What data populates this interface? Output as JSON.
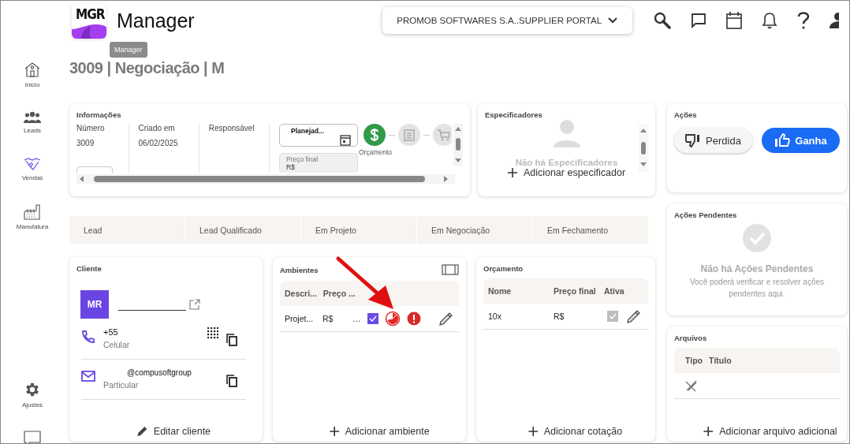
{
  "header": {
    "logo": "MGR",
    "app_name": "Manager",
    "portal": "PROMOB SOFTWARES S.A..SUPPLIER PORTAL"
  },
  "sidebar": {
    "items": [
      {
        "label": "Inicio",
        "selected": false
      },
      {
        "label": "Leads",
        "selected": false
      },
      {
        "label": "Vendas",
        "selected": true
      },
      {
        "label": "Manufatura",
        "selected": false
      }
    ],
    "bottom_items": [
      {
        "label": "Ajustes",
        "selected": false
      },
      {
        "selected": false
      }
    ]
  },
  "title": "3009 | Negociação | M",
  "tooltip": "Manager",
  "info": {
    "title": "Informações",
    "fields": [
      {
        "label": "Número",
        "value": "3009"
      },
      {
        "label": "Criado em",
        "value": "06/02/2025"
      },
      {
        "label": "Responsável"
      }
    ],
    "date_field": {
      "value": "Planejad..."
    },
    "price_field": {
      "label": "Preço final",
      "value": "R$"
    },
    "steps": [
      {
        "label": "Orçamento",
        "done": true
      },
      {
        "done": false
      },
      {
        "done": false
      }
    ]
  },
  "specifiers": {
    "title": "Especificadores",
    "empty_text": "Não há Especificadores",
    "add_label": "Adicionar especificador"
  },
  "actions": {
    "title": "Ações",
    "buttons": [
      {
        "label": "Perdida",
        "kind": "lost"
      },
      {
        "label": "Ganha",
        "kind": "won"
      }
    ]
  },
  "stages": [
    "Lead",
    "Lead Qualificado",
    "Em Projeto",
    "Em Negociação",
    "Em Fechamento"
  ],
  "pending": {
    "title": "Ações Pendentes",
    "empty_title": "Não há Ações Pendentes",
    "empty_text": "Você poderá verificar e resolver ações pendentes aqui."
  },
  "client": {
    "title": "Cliente",
    "initials": "MR",
    "contacts": [
      {
        "kind": "phone",
        "value": "+55",
        "type": "Celular"
      },
      {
        "kind": "email",
        "value": "@compusoftgroup",
        "type": "Particular"
      }
    ],
    "edit_label": "Editar cliente"
  },
  "environments": {
    "title": "Ambientes",
    "columns": [
      "Descri...",
      "Preço ..."
    ],
    "rows": [
      {
        "cells": [
          "Projet...",
          "R$",
          "…"
        ],
        "checked": true
      }
    ],
    "add_label": "Adicionar ambiente"
  },
  "budget": {
    "title": "Orçamento",
    "columns": [
      "Nome",
      "Preço final",
      "Ativa"
    ],
    "rows": [
      {
        "cells": [
          "10x",
          "R$"
        ],
        "checked": true,
        "disabled": true
      }
    ],
    "add_label": "Adicionar cotação"
  },
  "files": {
    "title": "Arquivos",
    "columns": [
      "Tipo",
      "Título"
    ],
    "add_label": "Adicionar arquivo adicional"
  }
}
